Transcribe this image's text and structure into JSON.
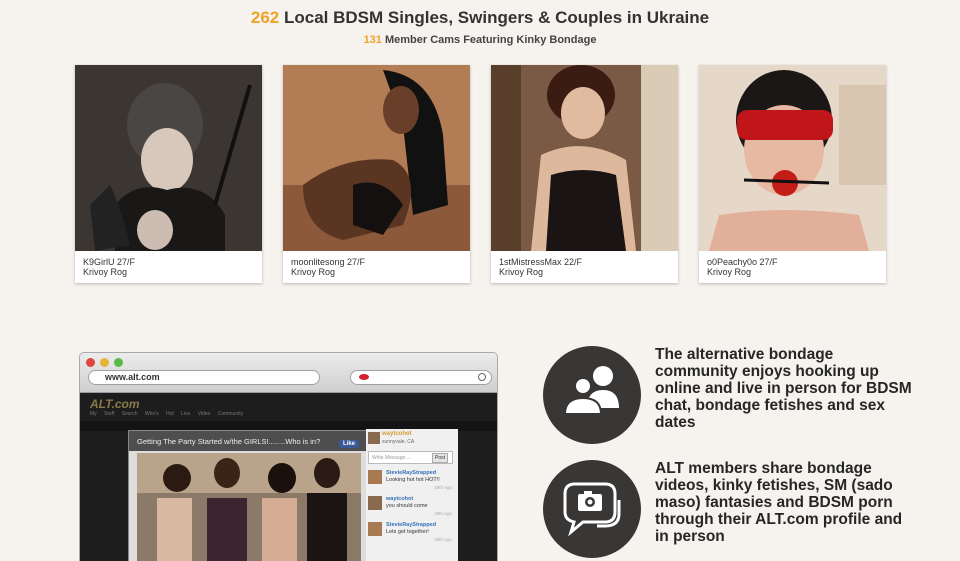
{
  "header": {
    "singles_count": "262",
    "singles_text": "Local BDSM Singles, Swingers & Couples in Ukraine",
    "cams_count": "131",
    "cams_text": "Member Cams Featuring Kinky Bondage"
  },
  "profiles": [
    {
      "name": "K9GirlU 27/F",
      "city": "Krivoy Rog"
    },
    {
      "name": "moonlitesong 27/F",
      "city": "Krivoy Rog"
    },
    {
      "name": "1stMistressMax 22/F",
      "city": "Krivoy Rog"
    },
    {
      "name": "o0Peachy0o 27/F",
      "city": "Krivoy Rog"
    }
  ],
  "browser": {
    "url": "www.alt.com",
    "logo": "ALT.com",
    "nav": "My Stuff Search Who's Hot Live Video Community",
    "chat_title": "Getting The Party Started w/the GIRLS!........Who is in?",
    "like_label": "Like",
    "host_name": "waytcohot",
    "host_location": "sunnyvale, CA",
    "message_placeholder": "Write Message....",
    "post_label": "Post",
    "messages": [
      {
        "name": "StevieRayStrapped",
        "text": "Looking hot hot HOT!!",
        "time": "49th Ago"
      },
      {
        "name": "waytcohot",
        "text": "you should come",
        "time": "49th Ago"
      },
      {
        "name": "StevieRayStrapped",
        "text": "Lets get together!",
        "time": "49th Ago"
      }
    ]
  },
  "features": [
    {
      "icon": "people-icon",
      "text": "The alternative bondage community enjoys hooking up online and live in person for BDSM chat, bondage fetishes and sex dates"
    },
    {
      "icon": "camera-chat-icon",
      "text": "ALT members share bondage videos, kinky fetishes, SM (sado maso) fantasies and BDSM porn through their ALT.com profile and in person"
    }
  ],
  "colors": {
    "accent": "#f0a126",
    "background": "#f6f3ef",
    "icon_circle": "#393735"
  }
}
